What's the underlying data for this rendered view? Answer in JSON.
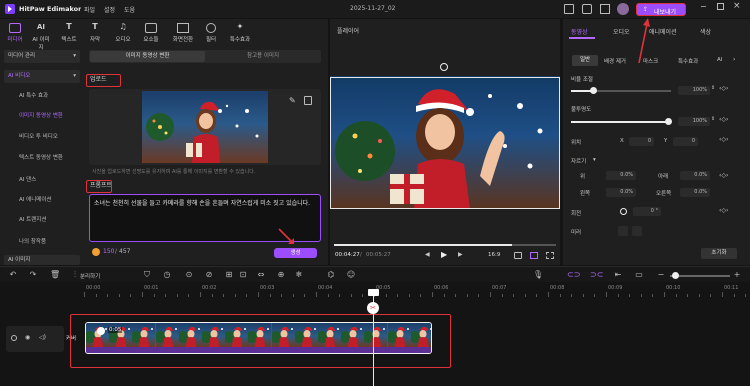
{
  "app": {
    "name": "HitPaw Edimakor",
    "menus": [
      "파일",
      "설정",
      "도움"
    ],
    "project_title": "2025-11-27_02",
    "export_label": "내보내기"
  },
  "toolbar": [
    {
      "label": "미디어"
    },
    {
      "label": "AI 이미지"
    },
    {
      "label": "텍스트"
    },
    {
      "label": "자막"
    },
    {
      "label": "오디오"
    },
    {
      "label": "요소들"
    },
    {
      "label": "화면전환"
    },
    {
      "label": "필터"
    },
    {
      "label": "특수효과"
    }
  ],
  "sidebar": {
    "head1": "미디어 관리",
    "head2": "AI 비디오",
    "items": [
      "AI 특수 효과",
      "이미지 동영상 변환",
      "비디오 투 비디오",
      "텍스트 동영상 변환",
      "AI 댄스",
      "AI 애니메이션",
      "AI 트랜지션",
      "나의 창작품"
    ],
    "head3": "AI 이미지"
  },
  "gen_panel": {
    "tab_active": "이미지 동영상 변환",
    "tab_other": "참고용 이미지",
    "upload_label": "업로드",
    "hint": "사진을 업로드하면 선명도를 유지하며 AI를 통해 이미지를 변환할 수 있습니다.",
    "prompt_label": "프롬프트",
    "prompt_text": "소녀는 천천히 선물을 들고 카메라를 향해 손을 흔들며 자연스럽게 미소 짓고 있습니다.",
    "credits": "150",
    "credits_max": "457",
    "generate_label": "생성"
  },
  "player": {
    "label": "플레이어",
    "current_time": "00:04:27",
    "total_time": "00:05:27",
    "ratio": "16:9",
    "progress": 0.8
  },
  "props": {
    "tabs": [
      "동영상",
      "오디오",
      "애니메이션",
      "색상"
    ],
    "subtabs": [
      "일반",
      "배경 제거",
      "마스크",
      "특수효과",
      "AI"
    ],
    "scale_label": "비율 조절",
    "scale_value": "100%",
    "opacity_label": "불투명도",
    "opacity_value": "100%",
    "position_label": "위치",
    "pos_x_label": "X",
    "pos_x_value": "0",
    "pos_y_label": "Y",
    "pos_y_value": "0",
    "crop_label": "자르기",
    "crop_top_label": "위",
    "crop_top": "0.0%",
    "crop_bottom_label": "아래",
    "crop_bottom": "0.0%",
    "crop_left_label": "왼쪽",
    "crop_left": "0.0%",
    "crop_right_label": "오른쪽",
    "crop_right": "0.0%",
    "rotate_label": "회전",
    "rotate_value": "0",
    "mirror_label": "미러",
    "reset_label": "초기화"
  },
  "timeline": {
    "split_label": "분리하기",
    "ruler": [
      "00:00",
      "00:01",
      "00:02",
      "00:03",
      "00:04",
      "00:05",
      "00:06",
      "00:07",
      "00:08",
      "00:09",
      "00:10",
      "00:11"
    ],
    "track_label": "커버",
    "clip_duration": "0:05"
  },
  "colors": {
    "accent": "#9b4dff",
    "highlight": "#e0323a",
    "bg": "#141414"
  }
}
